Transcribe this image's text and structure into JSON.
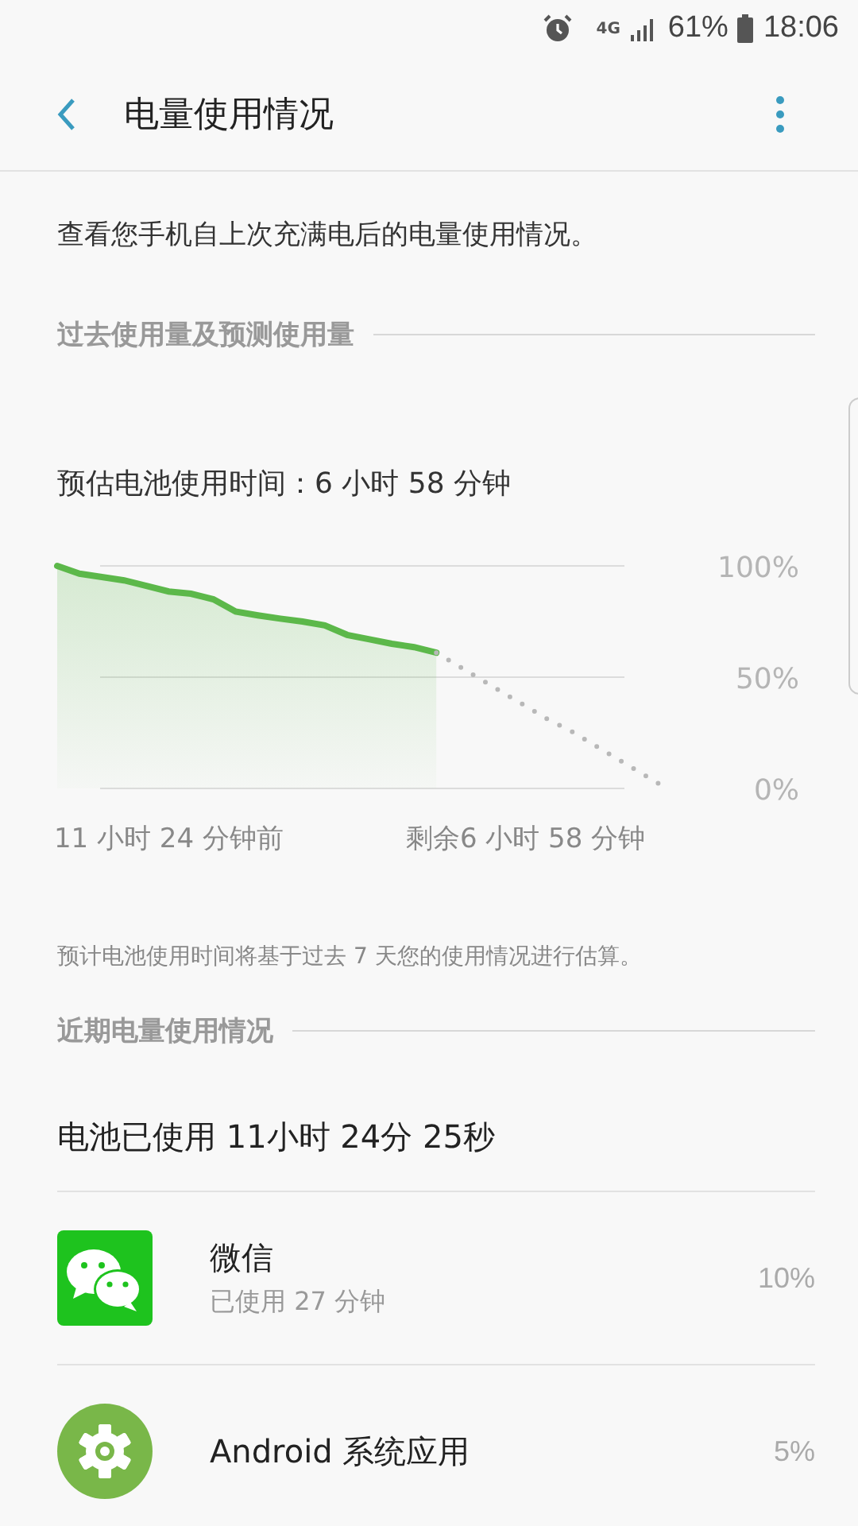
{
  "status_bar": {
    "network": "4G",
    "battery": "61%",
    "time": "18:06"
  },
  "app_bar": {
    "title": "电量使用情况"
  },
  "description": "查看您手机自上次充满电后的电量使用情况。",
  "usage_section": {
    "header": "过去使用量及预测使用量",
    "estimate": "预估电池使用时间：6 小时 58 分钟",
    "chart_data": {
      "type": "area",
      "categories": [
        null,
        null,
        null,
        null,
        null,
        "11 小时 24 分钟前",
        null,
        null,
        null,
        null,
        null,
        null,
        null,
        null,
        null,
        null,
        null,
        null,
        null,
        null,
        null,
        "剩余6 小时 58 分钟",
        null,
        null,
        null,
        null,
        null,
        null
      ],
      "ylim": [
        0,
        100
      ],
      "yticks": [
        {
          "value": 100,
          "label": "100%"
        },
        {
          "value": 50,
          "label": "50%"
        },
        {
          "value": 0,
          "label": "0%"
        }
      ],
      "series": [
        {
          "color": "#5cb84a",
          "values": [
            100,
            96.5,
            95,
            93.5,
            91,
            88.5,
            87.5,
            85,
            79.5,
            77.8,
            76.3,
            75,
            73.3,
            69,
            67,
            65,
            63.5,
            61,
            null,
            null,
            null,
            null,
            null,
            null,
            null,
            null,
            null,
            null
          ]
        },
        {
          "type": "line",
          "color": "#b8b8b8",
          "line_style": "dotted",
          "values": [
            null,
            null,
            null,
            null,
            null,
            null,
            null,
            null,
            null,
            null,
            null,
            null,
            null,
            null,
            null,
            null,
            null,
            61,
            55,
            49,
            43,
            37,
            31,
            26,
            20,
            14,
            8,
            2
          ]
        }
      ]
    },
    "note": "预计电池使用时间将基于过去 7 天您的使用情况进行估算。"
  },
  "recent_section": {
    "header": "近期电量使用情况",
    "total": "电池已使用 11小时 24分 25秒",
    "apps": [
      {
        "kind": "chat",
        "name": "微信",
        "detail": "已使用 27 分钟",
        "percent": "10%"
      },
      {
        "kind": "system",
        "name": "Android 系统应用",
        "percent": "5%"
      }
    ]
  }
}
